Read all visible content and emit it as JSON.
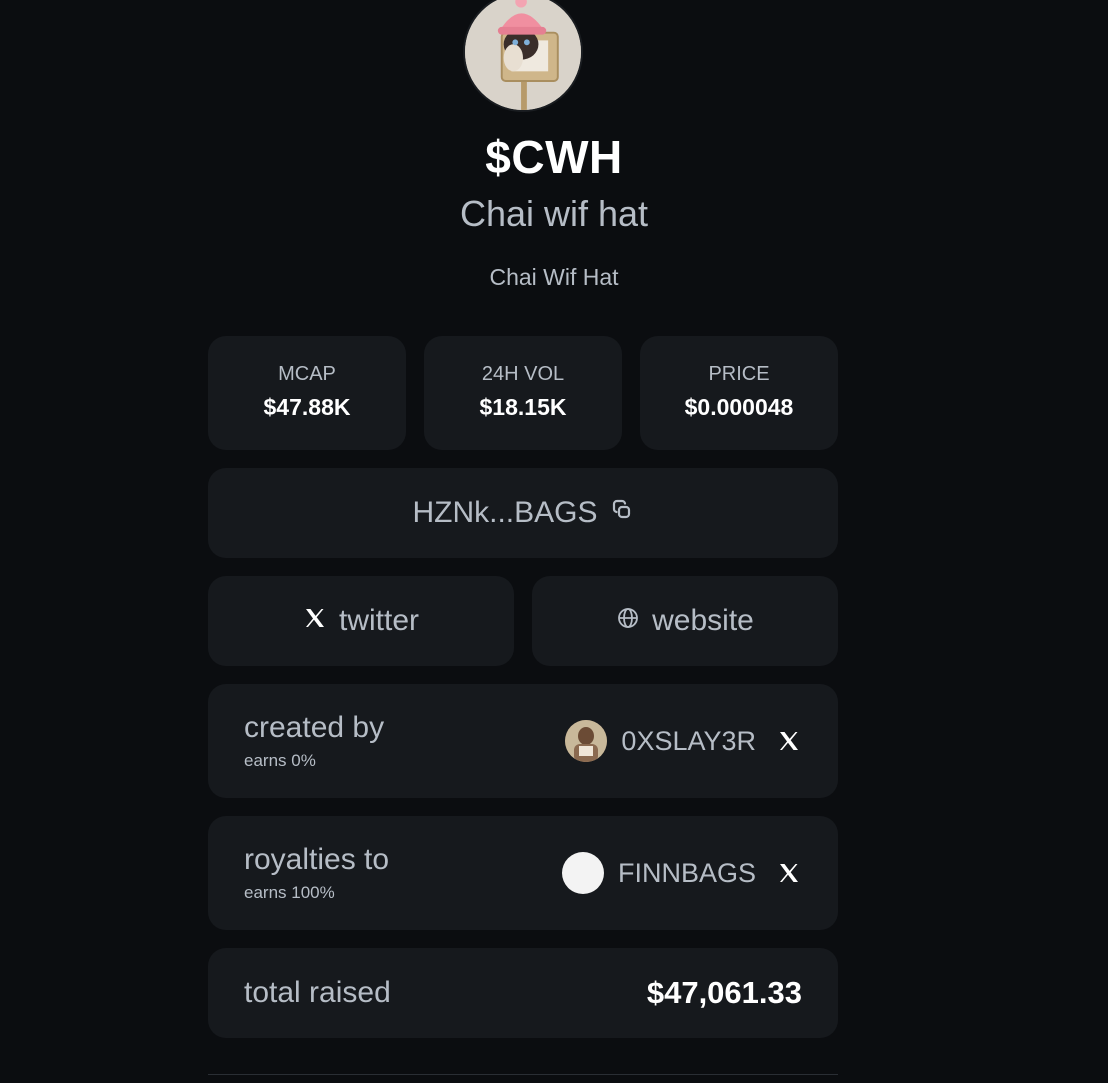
{
  "token": {
    "ticker": "$CWH",
    "name": "Chai wif hat",
    "description": "Chai Wif Hat",
    "avatar_icon": "cat-with-pink-beanie-avatar"
  },
  "stats": [
    {
      "label": "MCAP",
      "value": "$47.88K"
    },
    {
      "label": "24H VOL",
      "value": "$18.15K"
    },
    {
      "label": "PRICE",
      "value": "$0.000048"
    }
  ],
  "contract": {
    "address": "HZNk...BAGS",
    "copy_icon": "copy-icon"
  },
  "links": {
    "twitter_label": "twitter",
    "twitter_icon": "x-logo-icon",
    "website_label": "website",
    "website_icon": "globe-icon"
  },
  "creator": {
    "title": "created by",
    "earns": "earns 0%",
    "username": "0XSLAY3R"
  },
  "royalties": {
    "title": "royalties to",
    "earns": "earns 100%",
    "username": "FINNBAGS"
  },
  "total": {
    "label": "total raised",
    "amount": "$47,061.33"
  },
  "colors": {
    "background": "#0b0d10",
    "card": "#16191d",
    "muted_text": "#b6bdc6",
    "strong_text": "#ffffff"
  }
}
